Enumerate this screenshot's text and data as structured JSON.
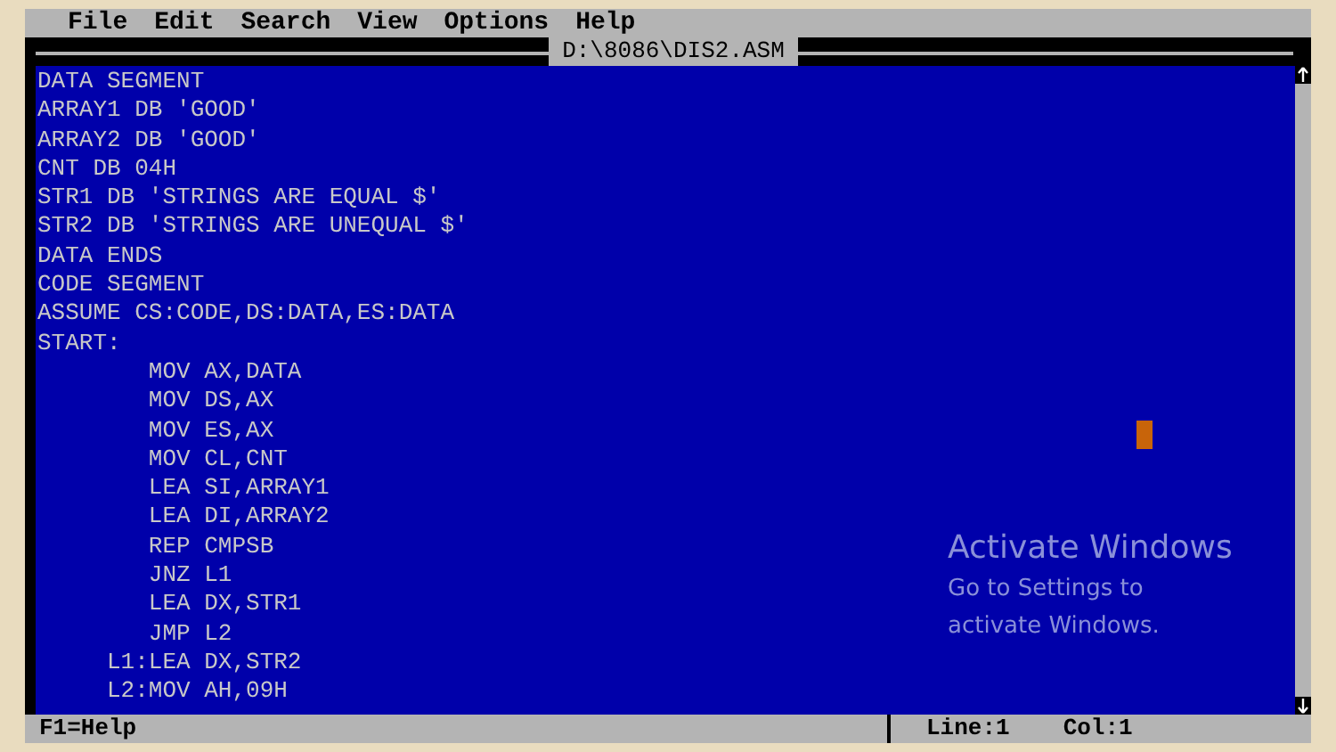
{
  "menu": [
    "File",
    "Edit",
    "Search",
    "View",
    "Options",
    "Help"
  ],
  "window": {
    "title": "D:\\8086\\DIS2.ASM"
  },
  "editor": {
    "lines": [
      "DATA SEGMENT",
      "ARRAY1 DB 'GOOD'",
      "ARRAY2 DB 'GOOD'",
      "CNT DB 04H",
      "STR1 DB 'STRINGS ARE EQUAL $'",
      "STR2 DB 'STRINGS ARE UNEQUAL $'",
      "DATA ENDS",
      "CODE SEGMENT",
      "ASSUME CS:CODE,DS:DATA,ES:DATA",
      "START:",
      "        MOV AX,DATA",
      "        MOV DS,AX",
      "        MOV ES,AX",
      "        MOV CL,CNT",
      "        LEA SI,ARRAY1",
      "        LEA DI,ARRAY2",
      "        REP CMPSB",
      "        JNZ L1",
      "        LEA DX,STR1",
      "        JMP L2",
      "     L1:LEA DX,STR2",
      "     L2:MOV AH,09H"
    ]
  },
  "activation_notice": {
    "title": "Activate Windows",
    "message": [
      "Go to Settings to",
      "activate Windows."
    ]
  },
  "status_bar": {
    "help": "F1=Help",
    "line": "Line:1",
    "col": "Col:1"
  }
}
